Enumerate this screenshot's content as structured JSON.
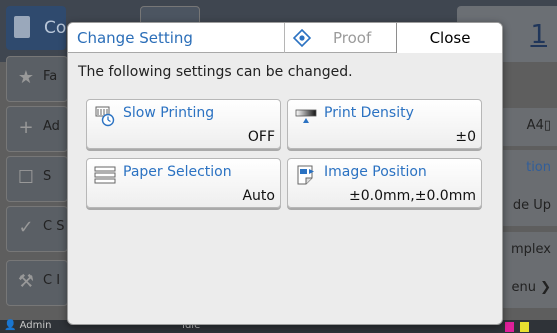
{
  "background": {
    "title_fragment": "Co",
    "copies": "1",
    "sidebar_fragments": [
      "Fa",
      "Ad",
      "S",
      "C\nS",
      "C\nI"
    ],
    "right_buttons": [
      "A4▯",
      "tion",
      "de Up",
      "mplex",
      "enu ❯"
    ],
    "status_user": "Admin",
    "status_text": "Idle"
  },
  "dialog": {
    "title": "Change Setting",
    "proof_label": "Proof",
    "close_label": "Close",
    "description": "The following settings can be changed.",
    "settings": [
      {
        "icon": "slow-printing-icon",
        "label": "Slow Printing",
        "value": "OFF"
      },
      {
        "icon": "print-density-icon",
        "label": "Print Density",
        "value": "±0"
      },
      {
        "icon": "paper-selection-icon",
        "label": "Paper Selection",
        "value": "Auto"
      },
      {
        "icon": "image-position-icon",
        "label": "Image Position",
        "value": "±0.0mm,±0.0mm"
      }
    ]
  },
  "colors": {
    "accent": "#2b72c2",
    "title": "#2b6eb8",
    "proof_disabled": "#9b9b9b"
  }
}
